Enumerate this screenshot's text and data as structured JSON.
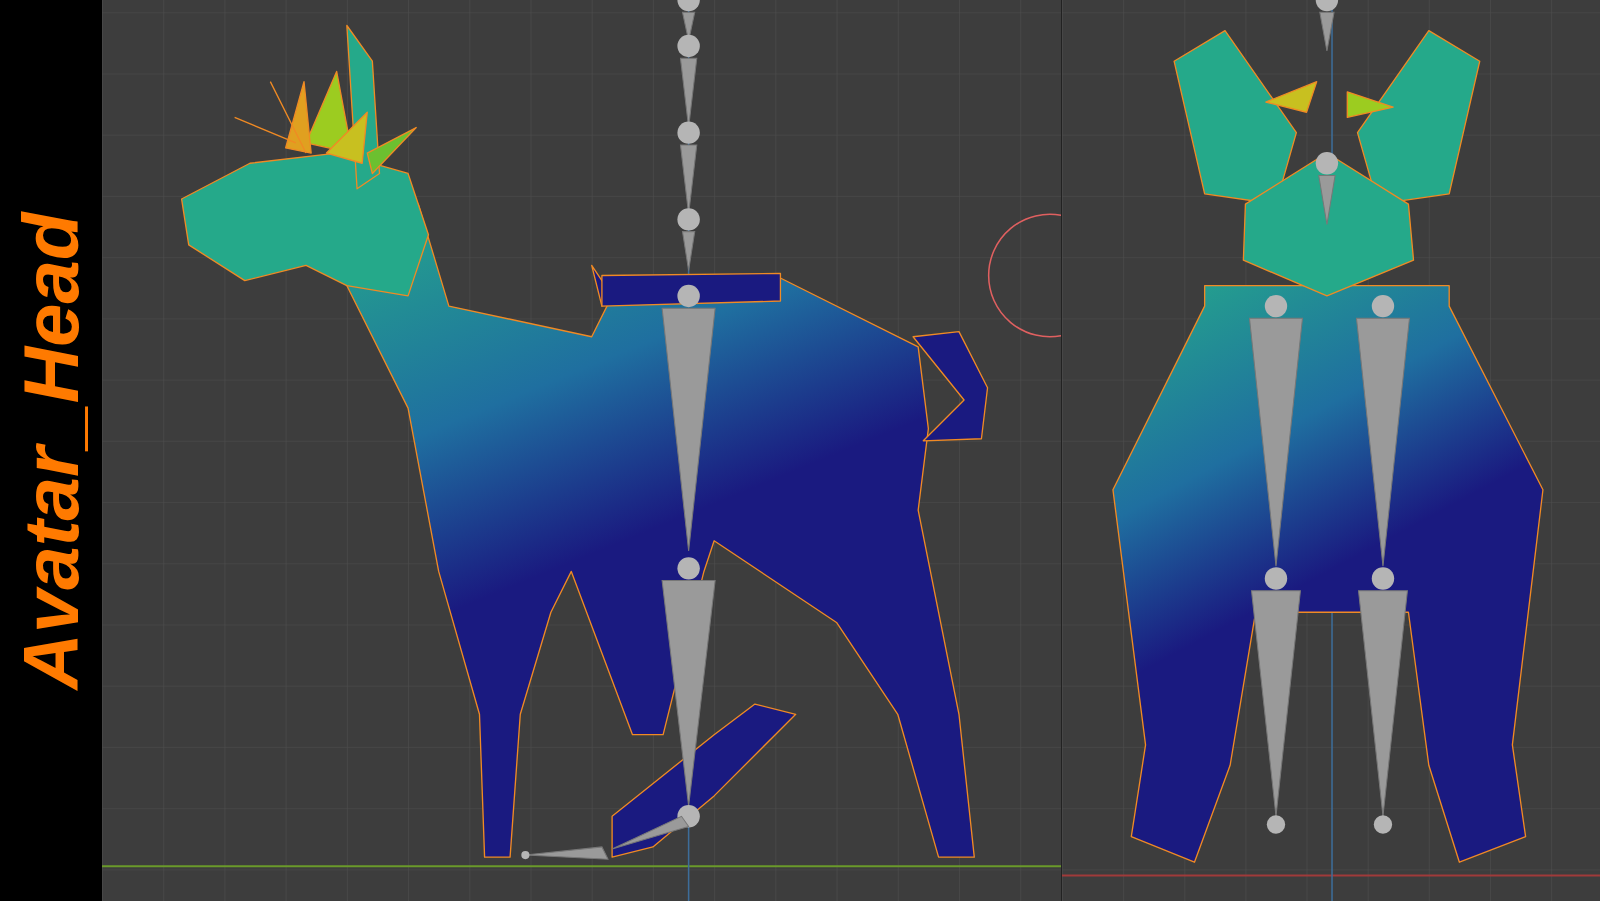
{
  "title_label": "Avatar_Head",
  "viewports": [
    {
      "kind": "side"
    },
    {
      "kind": "front"
    }
  ]
}
